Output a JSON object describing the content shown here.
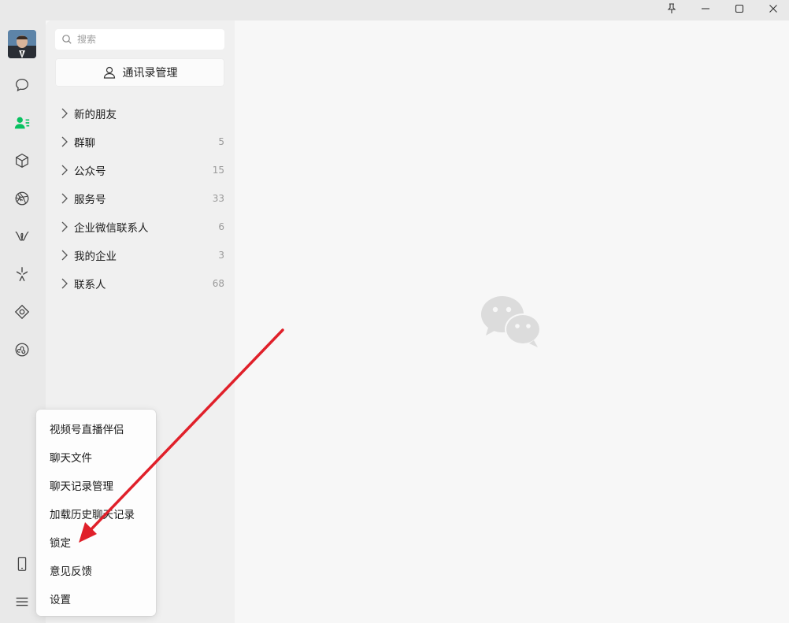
{
  "window": {
    "buttons": [
      {
        "name": "pin-icon",
        "glyph": "⚲"
      },
      {
        "name": "minimize-icon",
        "glyph": "—"
      },
      {
        "name": "maximize-icon",
        "glyph": "☐"
      },
      {
        "name": "close-icon",
        "glyph": "✕"
      }
    ]
  },
  "rail": {
    "icons": [
      "chat-icon",
      "contacts-icon",
      "favorites-icon",
      "moments-icon",
      "channels-icon",
      "discover-icon",
      "search-square-icon",
      "miniprogram-icon",
      "phone-icon",
      "menu-icon"
    ],
    "active": "contacts-icon",
    "accent_color": "#07c160"
  },
  "search": {
    "placeholder": "搜索"
  },
  "contacts": {
    "manage_label": "通讯录管理",
    "groups": [
      {
        "label": "新的朋友",
        "count": ""
      },
      {
        "label": "群聊",
        "count": "5"
      },
      {
        "label": "公众号",
        "count": "15"
      },
      {
        "label": "服务号",
        "count": "33"
      },
      {
        "label": "企业微信联系人",
        "count": "6"
      },
      {
        "label": "我的企业",
        "count": "3"
      },
      {
        "label": "联系人",
        "count": "68"
      }
    ]
  },
  "menu": {
    "items": [
      "视频号直播伴侣",
      "聊天文件",
      "聊天记录管理",
      "加载历史聊天记录",
      "锁定",
      "意见反馈",
      "设置"
    ]
  },
  "annotation": {
    "color": "#e0202a"
  }
}
